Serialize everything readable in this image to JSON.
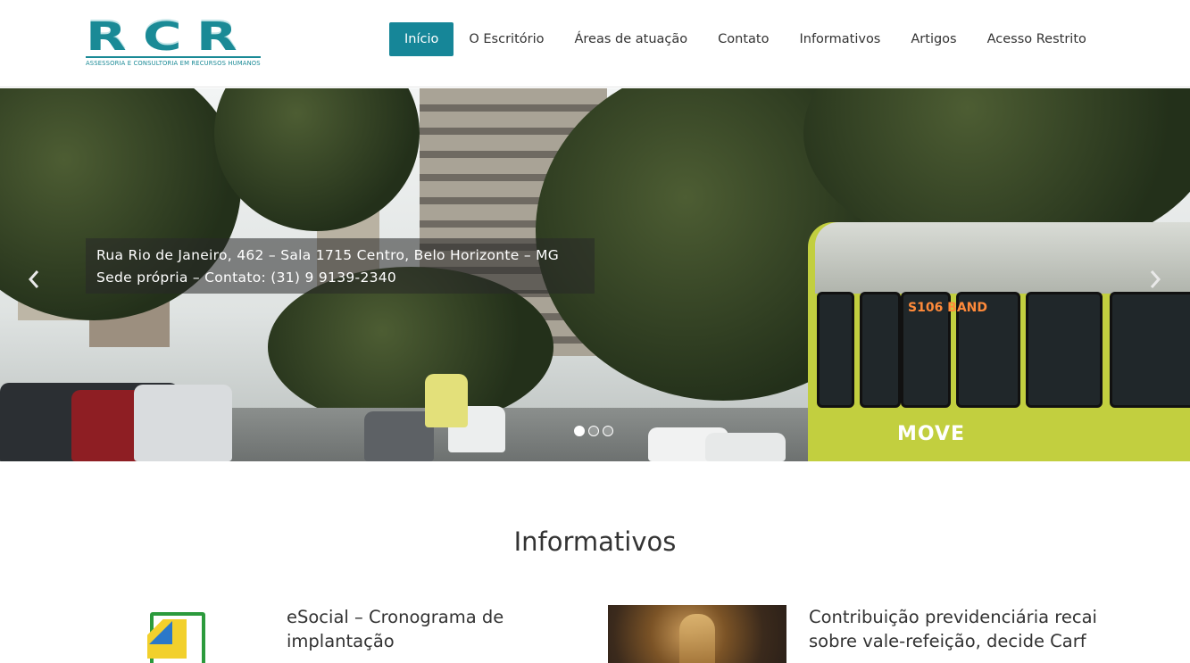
{
  "logo": {
    "letters": [
      "R",
      "C",
      "R"
    ],
    "tagline": "ASSESSORIA E CONSULTORIA EM RECURSOS HUMANOS"
  },
  "nav": {
    "items": [
      {
        "label": "Início",
        "active": true
      },
      {
        "label": "O Escritório",
        "active": false
      },
      {
        "label": "Áreas de atuação",
        "active": false
      },
      {
        "label": "Contato",
        "active": false
      },
      {
        "label": "Informativos",
        "active": false
      },
      {
        "label": "Artigos",
        "active": false
      },
      {
        "label": "Acesso Restrito",
        "active": false
      }
    ],
    "active_color": "#168698"
  },
  "hero": {
    "caption_line1": "Rua Rio de Janeiro, 462 – Sala 1715 Centro, Belo Horizonte – MG",
    "caption_line2": "Sede própria  –  Contato: (31) 9 9139-2340",
    "prev_icon": "chevron-left-icon",
    "next_icon": "chevron-right-icon",
    "slide_count": 3,
    "active_slide": 1,
    "bus_brand": "MOVE",
    "bus_destination": "S106 BAND"
  },
  "informativos": {
    "title": "Informativos",
    "cards": [
      {
        "title": "eSocial – Cronograma de implantação",
        "image": "document-icon"
      },
      {
        "title": "Contribuição previdenciária recai sobre vale-refeição, decide Carf",
        "image": "justice-statue-photo"
      }
    ]
  }
}
